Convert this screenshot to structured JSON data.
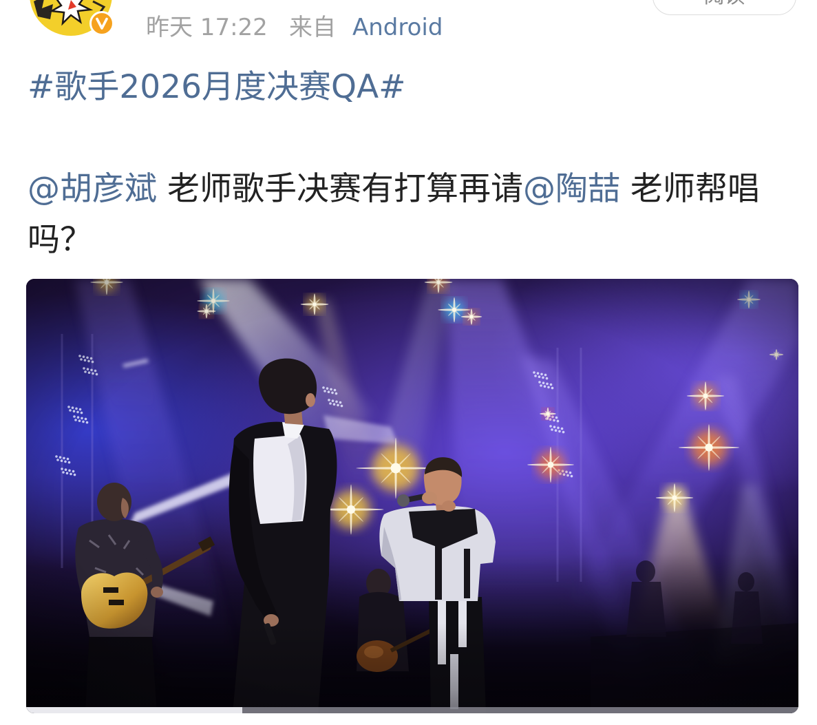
{
  "header": {
    "timestamp": "昨天 17:22",
    "source_prefix": "来自",
    "source": "Android",
    "read_button_label": "阅读"
  },
  "avatar": {
    "icon": "user-avatar",
    "badge_icon": "verified-badge-icon",
    "badge_color": "#f6a21e"
  },
  "post": {
    "hashtag": "#歌手2026月度决赛QA#",
    "mention_1": "@胡彦斌",
    "text_1": " 老师歌手决赛有打算再请",
    "mention_2": "@陶喆",
    "text_2": " 老师帮唱",
    "text_3": "吗？"
  },
  "video": {
    "icon": "video-thumbnail",
    "progress": 0.28
  },
  "colors": {
    "link": "#4f6d94",
    "text": "#222222",
    "meta": "#a2a2a2",
    "source_link": "#5a7aa2"
  }
}
